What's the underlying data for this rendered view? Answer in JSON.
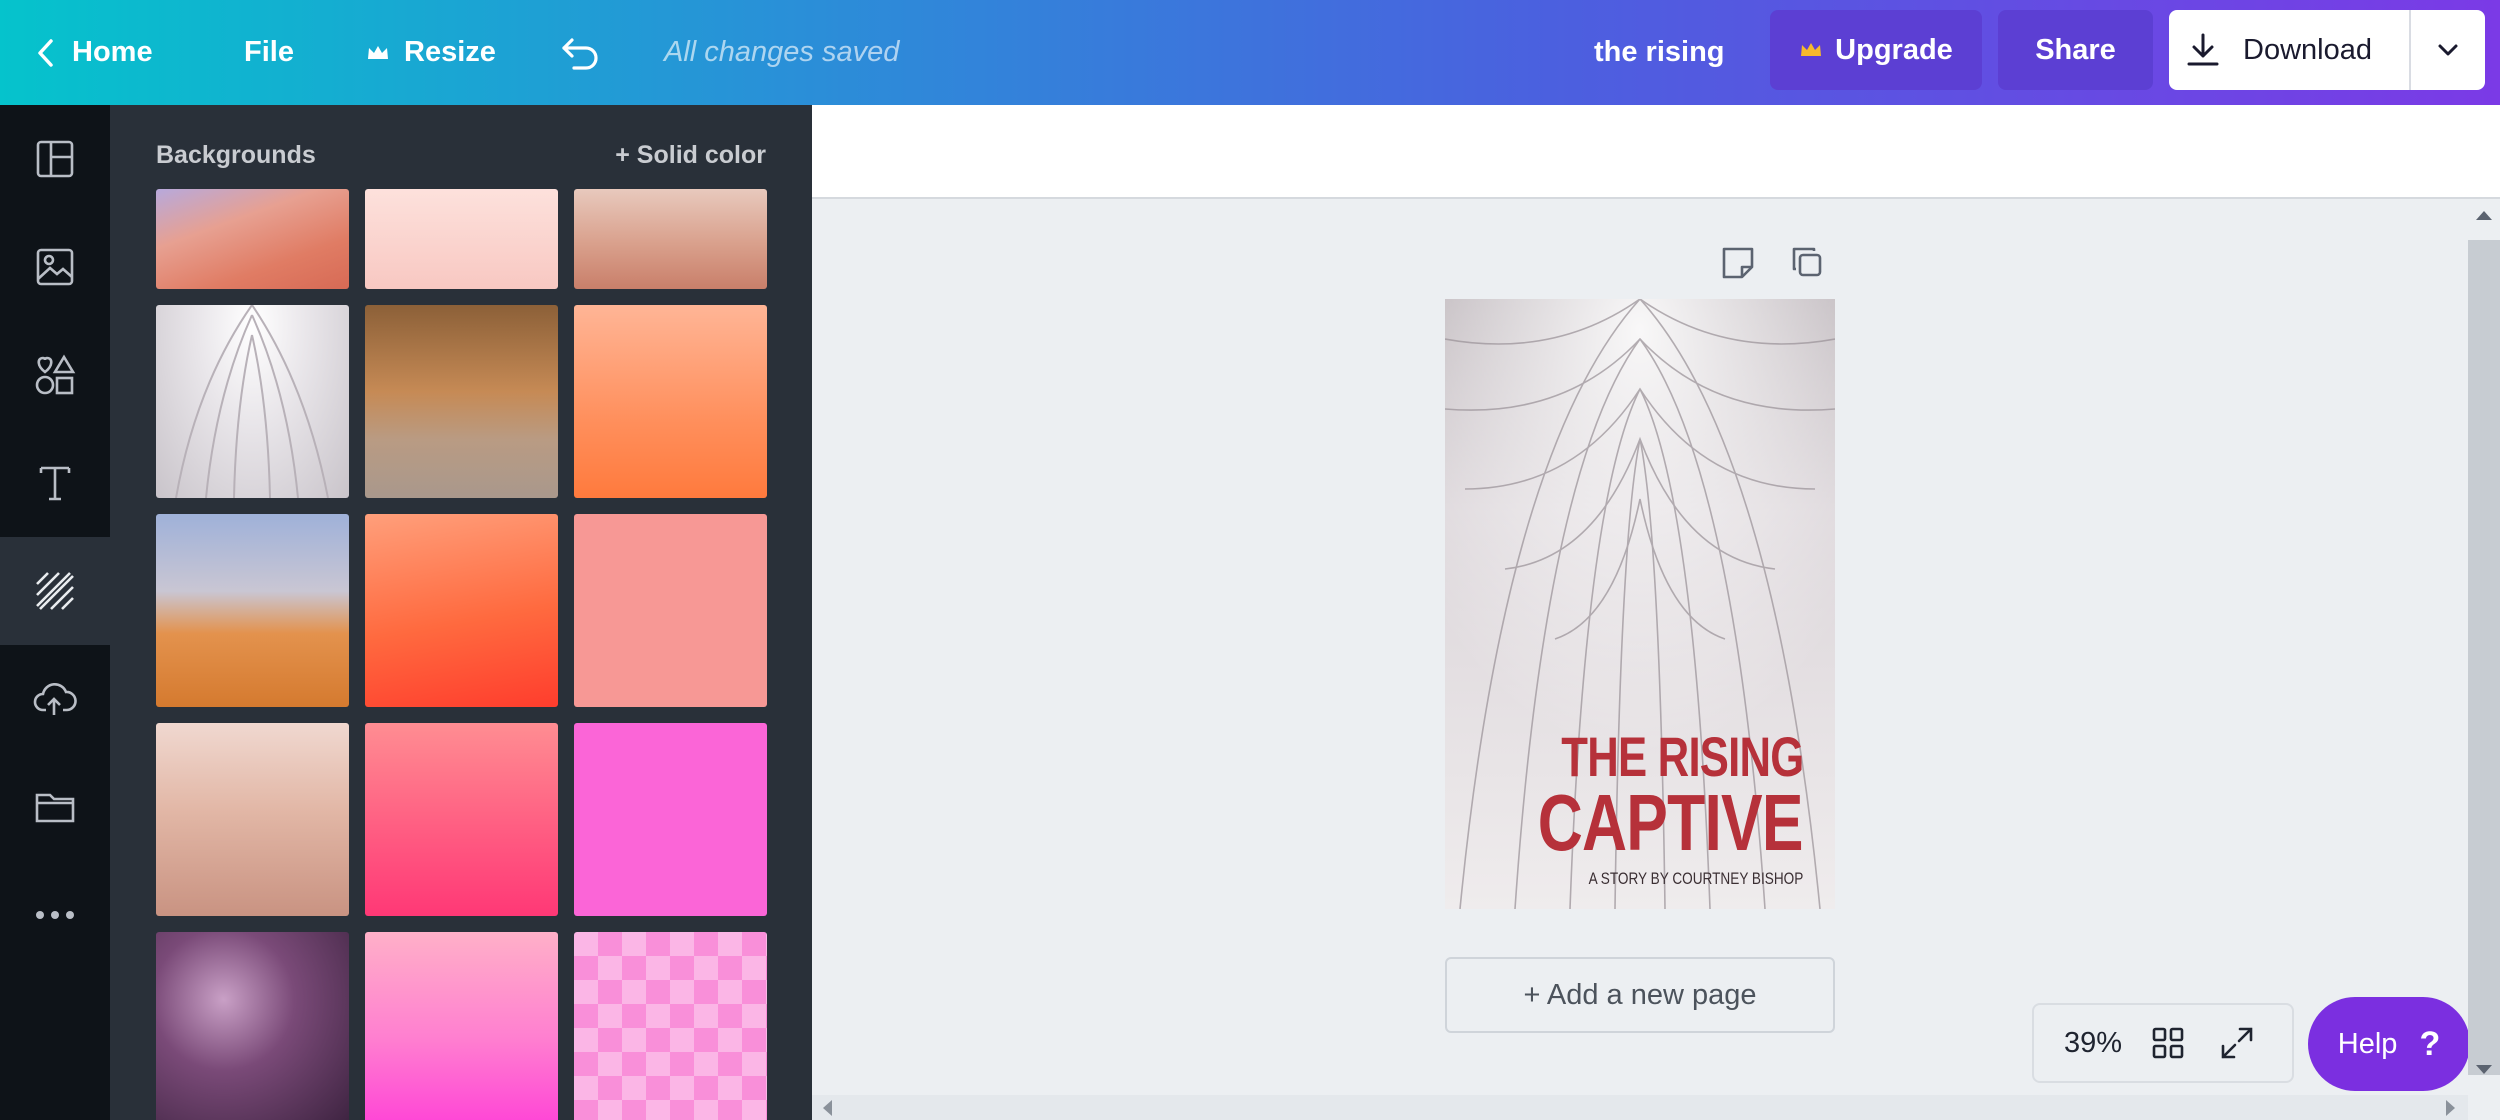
{
  "topbar": {
    "home_label": "Home",
    "file_label": "File",
    "resize_label": "Resize",
    "save_status": "All changes saved",
    "doc_title": "the rising",
    "upgrade_label": "Upgrade",
    "share_label": "Share",
    "download_label": "Download"
  },
  "rail": {
    "items": [
      "templates",
      "photos",
      "elements",
      "text",
      "backgrounds",
      "uploads",
      "folders",
      "more"
    ],
    "active": "backgrounds"
  },
  "panel": {
    "title": "Backgrounds",
    "solid_color_label": "+ Solid color"
  },
  "canvas": {
    "cover_line1": "THE RISING",
    "cover_line2": "CAPTIVE",
    "cover_byline": "A STORY BY COURTNEY BISHOP",
    "add_page_label": "+ Add a new page"
  },
  "footer": {
    "zoom": "39%",
    "help_label": "Help",
    "help_icon": "?"
  },
  "colors": {
    "accent_purple": "#7b2fe0",
    "cover_red": "#b6313a"
  }
}
